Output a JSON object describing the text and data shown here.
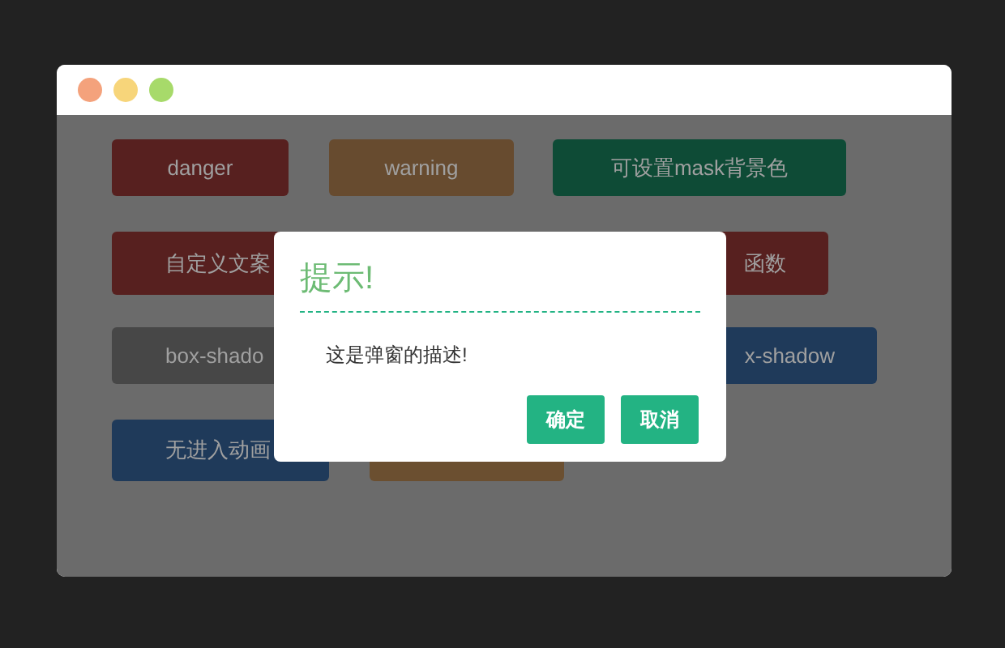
{
  "window": {
    "dots": [
      {
        "color": "#f4a27c"
      },
      {
        "color": "#f7d57a"
      },
      {
        "color": "#a7da6a"
      }
    ]
  },
  "rows": [
    {
      "buttons": [
        {
          "label": "danger",
          "color": "#57201f"
        },
        {
          "label": "warning",
          "color": "#674b2f"
        },
        {
          "label": "可设置mask背景色",
          "color": "#0e4b36"
        }
      ]
    },
    {
      "buttons": [
        {
          "label": "自定义文案",
          "color": "#57201f"
        },
        {
          "label": "函数",
          "color": "#57201f"
        }
      ]
    },
    {
      "buttons": [
        {
          "label": "box-shado",
          "color": "#474747"
        },
        {
          "label": "x-shadow",
          "color": "#1f3a5a"
        }
      ]
    },
    {
      "buttons": [
        {
          "label": "无进入动画",
          "color": "#1f3a5a"
        },
        {
          "color": "#6b4f30"
        }
      ]
    }
  ],
  "dialog": {
    "title": "提示!",
    "message": "这是弹窗的描述!",
    "buttons": [
      "确定",
      "取消"
    ]
  }
}
